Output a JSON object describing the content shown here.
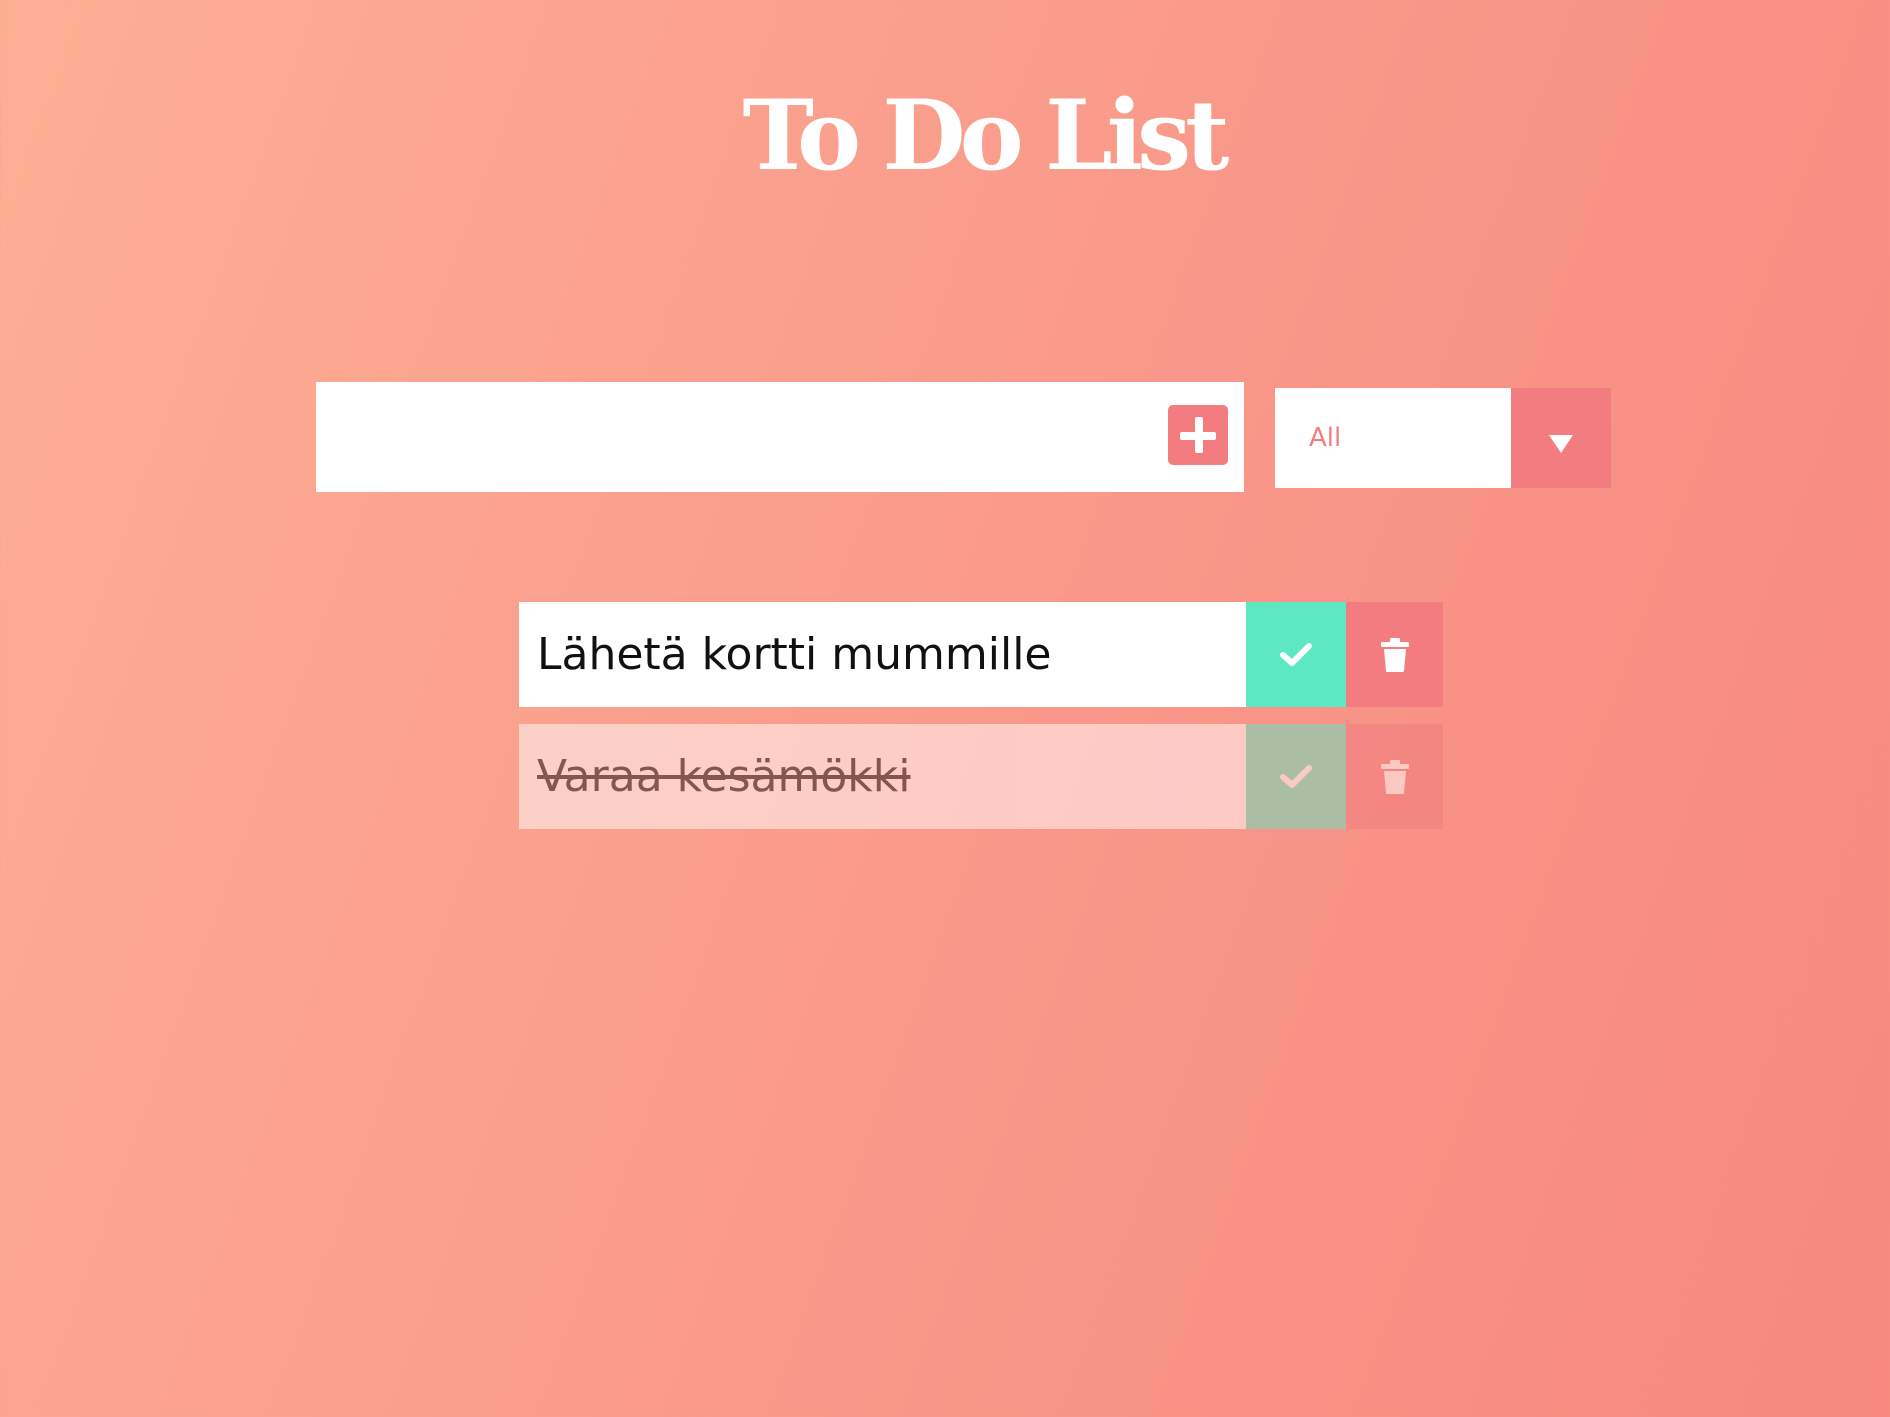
{
  "header": {
    "title": "To Do List"
  },
  "add_form": {
    "input_value": "",
    "add_icon": "plus-icon"
  },
  "filter": {
    "selected": "All",
    "dropdown_icon": "chevron-down-icon"
  },
  "todos": [
    {
      "text": "Lähetä kortti mummille",
      "completed": false,
      "complete_icon": "check-icon",
      "delete_icon": "trash-icon"
    },
    {
      "text": "Varaa kesämökki",
      "completed": true,
      "complete_icon": "check-icon",
      "delete_icon": "trash-icon"
    }
  ],
  "colors": {
    "background_start": "#fdaf94",
    "background_end": "#f7877f",
    "accent": "#f27c80",
    "complete": "#5de8c3",
    "text": "#111111",
    "title": "#ffffff"
  }
}
